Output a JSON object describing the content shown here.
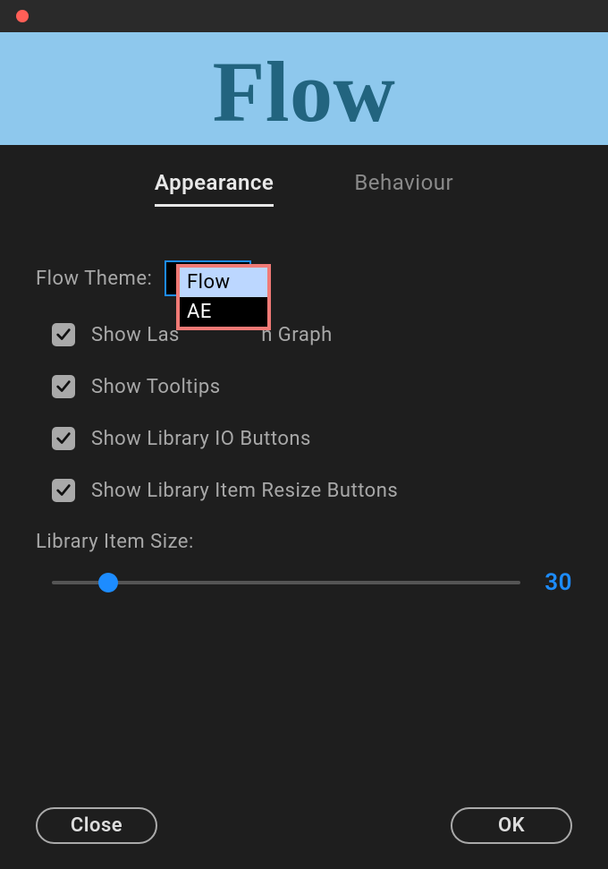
{
  "banner": {
    "logo_text": "Flow"
  },
  "tabs": {
    "appearance": "Appearance",
    "behaviour": "Behaviour",
    "active": "appearance"
  },
  "theme": {
    "label": "Flow Theme:",
    "selected": "Flow",
    "options": [
      "Flow",
      "AE"
    ]
  },
  "checks": {
    "show_graph_label_pre": "Show Las",
    "show_graph_label_post": "n Graph",
    "tooltips": "Show Tooltips",
    "io": "Show Library IO Buttons",
    "resize": "Show Library Item Resize Buttons"
  },
  "slider": {
    "label": "Library Item Size:",
    "value": "30",
    "percent": 12
  },
  "footer": {
    "close": "Close",
    "ok": "OK"
  }
}
